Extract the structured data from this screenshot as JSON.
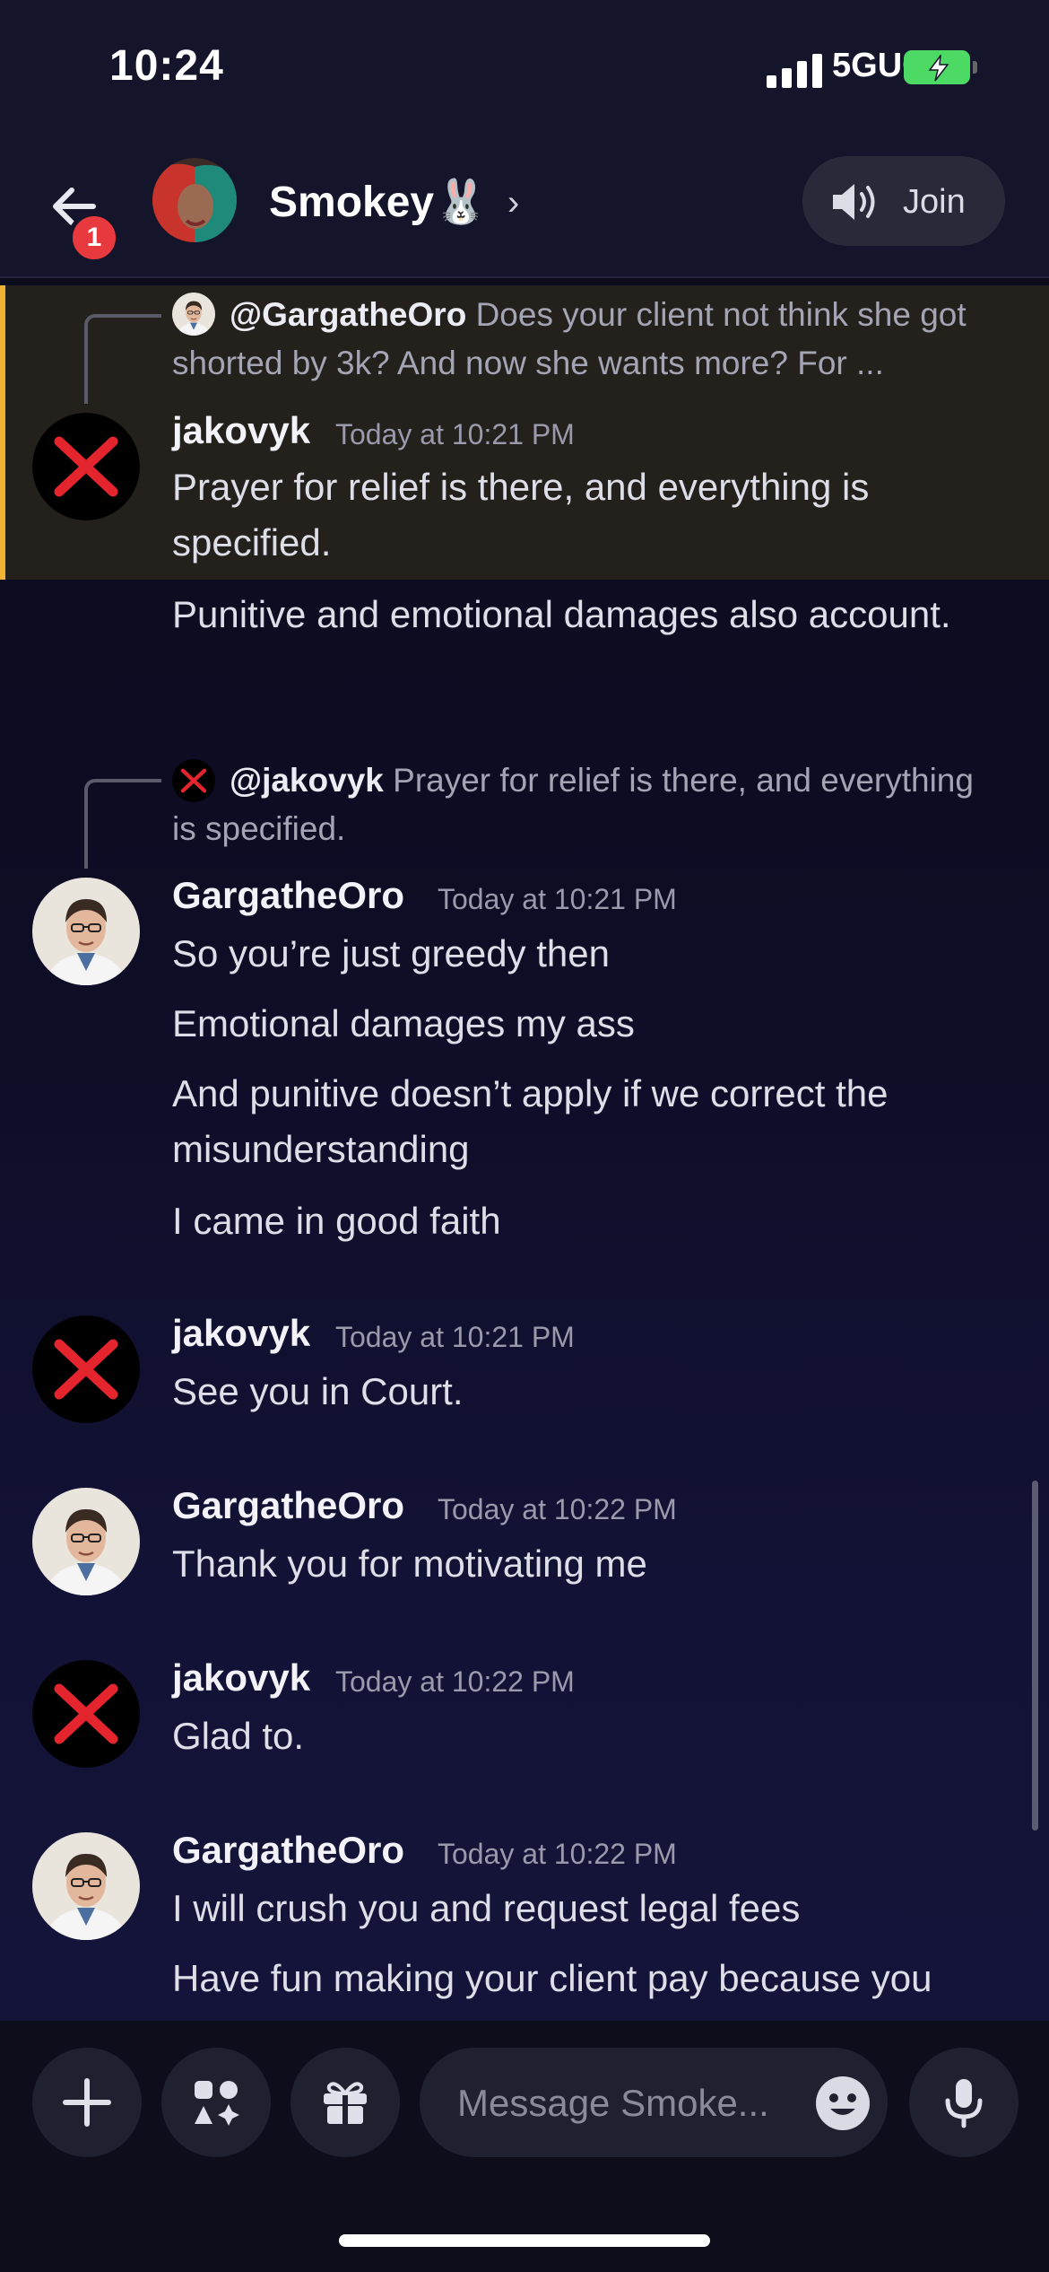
{
  "status_bar": {
    "time": "10:24",
    "network": "5GUC",
    "battery_charging": true
  },
  "header": {
    "back_badge": "1",
    "channel_name": "Smokey🐰",
    "join_label": "Join"
  },
  "messages": [
    {
      "reply": {
        "author": "@GargatheOro",
        "text": "Does your client not think she got shorted by 3k? And now she wants more? For ..."
      },
      "author": "jakovyk",
      "timestamp": "Today at 10:21 PM",
      "lines": [
        "Prayer for relief is there, and everything is specified.",
        "Punitive and emotional damages also account."
      ]
    },
    {
      "reply": {
        "author": "@jakovyk",
        "text": "Prayer for relief is there, and everything is specified."
      },
      "author": "GargatheOro",
      "timestamp": "Today at 10:21 PM",
      "lines": [
        "So you’re just greedy then",
        "Emotional damages my ass",
        "And punitive doesn’t apply if we correct the misunderstanding",
        "I came in good faith"
      ]
    },
    {
      "author": "jakovyk",
      "timestamp": "Today at 10:21 PM",
      "lines": [
        "See you in Court."
      ]
    },
    {
      "author": "GargatheOro",
      "timestamp": "Today at 10:22 PM",
      "lines": [
        "Thank you for motivating me"
      ]
    },
    {
      "author": "jakovyk",
      "timestamp": "Today at 10:22 PM",
      "lines": [
        "Glad to."
      ]
    },
    {
      "author": "GargatheOro",
      "timestamp": "Today at 10:22 PM",
      "lines": [
        "I will crush you and request legal fees",
        "Have fun making your client pay because you"
      ]
    }
  ],
  "composer": {
    "placeholder": "Message Smoke..."
  },
  "colors": {
    "highlight_border": "#f0b232",
    "highlight_bg": "#24201c",
    "x_red": "#e4252d",
    "badge_red": "#e83a3e"
  },
  "icons": [
    "back-arrow-icon",
    "speaker-icon",
    "plus-icon",
    "apps-icon",
    "gift-icon",
    "emoji-icon",
    "microphone-icon"
  ]
}
